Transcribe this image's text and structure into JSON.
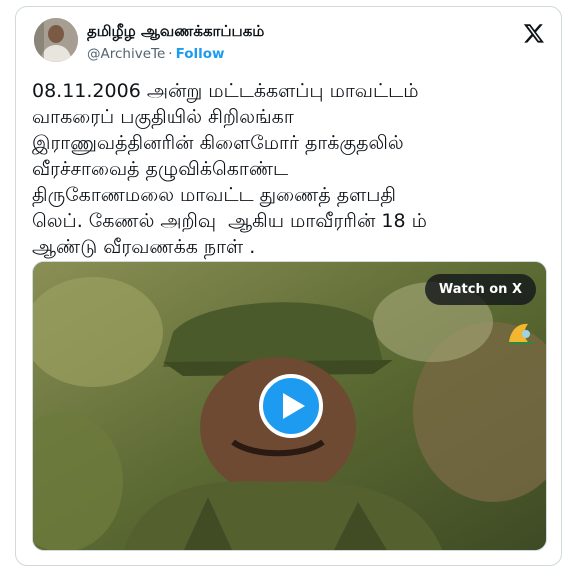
{
  "tweet": {
    "author_name": "தமிழீழ ஆவணக்காப்பகம்",
    "handle": "@ArchiveTe",
    "separator": "·",
    "follow_label": "Follow",
    "text": "08.11.2006 அன்று மட்டக்களப்பு மாவட்டம்\nவாகரைப் பகுதியில் சிறிலங்கா\nஇராணுவத்தினரின் கிளைமோர் தாக்குதலில்\nவீரச்சாவைத் தழுவிக்கொண்ட\nதிருகோணமலை மாவட்ட துணைத் தளபதி\nலெப். கேணல் அறிவு  ஆகிய மாவீரரின் 18 ம்\nஆண்டு வீரவணக்க நாள் ."
  },
  "media": {
    "watch_label": "Watch on X",
    "play_icon": "play-icon"
  },
  "colors": {
    "accent": "#1d9bf0",
    "text": "#0f1419",
    "muted": "#536471",
    "border": "#cfd9de"
  }
}
